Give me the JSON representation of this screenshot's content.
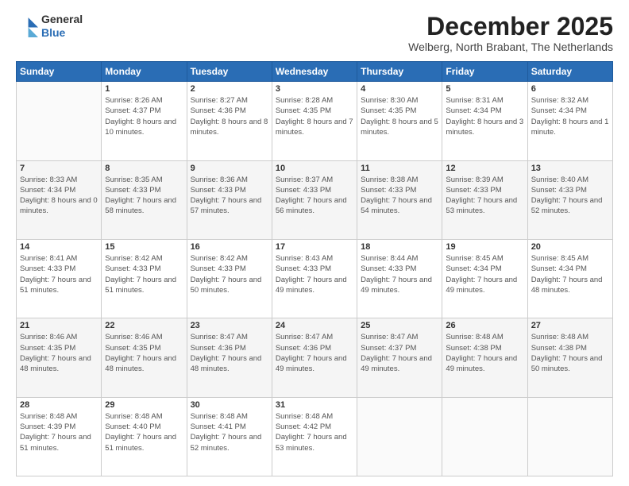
{
  "logo": {
    "general": "General",
    "blue": "Blue"
  },
  "header": {
    "month": "December 2025",
    "location": "Welberg, North Brabant, The Netherlands"
  },
  "weekdays": [
    "Sunday",
    "Monday",
    "Tuesday",
    "Wednesday",
    "Thursday",
    "Friday",
    "Saturday"
  ],
  "days": [
    {
      "date": "",
      "sunrise": "",
      "sunset": "",
      "daylight": ""
    },
    {
      "date": "1",
      "sunrise": "Sunrise: 8:26 AM",
      "sunset": "Sunset: 4:37 PM",
      "daylight": "Daylight: 8 hours and 10 minutes."
    },
    {
      "date": "2",
      "sunrise": "Sunrise: 8:27 AM",
      "sunset": "Sunset: 4:36 PM",
      "daylight": "Daylight: 8 hours and 8 minutes."
    },
    {
      "date": "3",
      "sunrise": "Sunrise: 8:28 AM",
      "sunset": "Sunset: 4:35 PM",
      "daylight": "Daylight: 8 hours and 7 minutes."
    },
    {
      "date": "4",
      "sunrise": "Sunrise: 8:30 AM",
      "sunset": "Sunset: 4:35 PM",
      "daylight": "Daylight: 8 hours and 5 minutes."
    },
    {
      "date": "5",
      "sunrise": "Sunrise: 8:31 AM",
      "sunset": "Sunset: 4:34 PM",
      "daylight": "Daylight: 8 hours and 3 minutes."
    },
    {
      "date": "6",
      "sunrise": "Sunrise: 8:32 AM",
      "sunset": "Sunset: 4:34 PM",
      "daylight": "Daylight: 8 hours and 1 minute."
    },
    {
      "date": "7",
      "sunrise": "Sunrise: 8:33 AM",
      "sunset": "Sunset: 4:34 PM",
      "daylight": "Daylight: 8 hours and 0 minutes."
    },
    {
      "date": "8",
      "sunrise": "Sunrise: 8:35 AM",
      "sunset": "Sunset: 4:33 PM",
      "daylight": "Daylight: 7 hours and 58 minutes."
    },
    {
      "date": "9",
      "sunrise": "Sunrise: 8:36 AM",
      "sunset": "Sunset: 4:33 PM",
      "daylight": "Daylight: 7 hours and 57 minutes."
    },
    {
      "date": "10",
      "sunrise": "Sunrise: 8:37 AM",
      "sunset": "Sunset: 4:33 PM",
      "daylight": "Daylight: 7 hours and 56 minutes."
    },
    {
      "date": "11",
      "sunrise": "Sunrise: 8:38 AM",
      "sunset": "Sunset: 4:33 PM",
      "daylight": "Daylight: 7 hours and 54 minutes."
    },
    {
      "date": "12",
      "sunrise": "Sunrise: 8:39 AM",
      "sunset": "Sunset: 4:33 PM",
      "daylight": "Daylight: 7 hours and 53 minutes."
    },
    {
      "date": "13",
      "sunrise": "Sunrise: 8:40 AM",
      "sunset": "Sunset: 4:33 PM",
      "daylight": "Daylight: 7 hours and 52 minutes."
    },
    {
      "date": "14",
      "sunrise": "Sunrise: 8:41 AM",
      "sunset": "Sunset: 4:33 PM",
      "daylight": "Daylight: 7 hours and 51 minutes."
    },
    {
      "date": "15",
      "sunrise": "Sunrise: 8:42 AM",
      "sunset": "Sunset: 4:33 PM",
      "daylight": "Daylight: 7 hours and 51 minutes."
    },
    {
      "date": "16",
      "sunrise": "Sunrise: 8:42 AM",
      "sunset": "Sunset: 4:33 PM",
      "daylight": "Daylight: 7 hours and 50 minutes."
    },
    {
      "date": "17",
      "sunrise": "Sunrise: 8:43 AM",
      "sunset": "Sunset: 4:33 PM",
      "daylight": "Daylight: 7 hours and 49 minutes."
    },
    {
      "date": "18",
      "sunrise": "Sunrise: 8:44 AM",
      "sunset": "Sunset: 4:33 PM",
      "daylight": "Daylight: 7 hours and 49 minutes."
    },
    {
      "date": "19",
      "sunrise": "Sunrise: 8:45 AM",
      "sunset": "Sunset: 4:34 PM",
      "daylight": "Daylight: 7 hours and 49 minutes."
    },
    {
      "date": "20",
      "sunrise": "Sunrise: 8:45 AM",
      "sunset": "Sunset: 4:34 PM",
      "daylight": "Daylight: 7 hours and 48 minutes."
    },
    {
      "date": "21",
      "sunrise": "Sunrise: 8:46 AM",
      "sunset": "Sunset: 4:35 PM",
      "daylight": "Daylight: 7 hours and 48 minutes."
    },
    {
      "date": "22",
      "sunrise": "Sunrise: 8:46 AM",
      "sunset": "Sunset: 4:35 PM",
      "daylight": "Daylight: 7 hours and 48 minutes."
    },
    {
      "date": "23",
      "sunrise": "Sunrise: 8:47 AM",
      "sunset": "Sunset: 4:36 PM",
      "daylight": "Daylight: 7 hours and 48 minutes."
    },
    {
      "date": "24",
      "sunrise": "Sunrise: 8:47 AM",
      "sunset": "Sunset: 4:36 PM",
      "daylight": "Daylight: 7 hours and 49 minutes."
    },
    {
      "date": "25",
      "sunrise": "Sunrise: 8:47 AM",
      "sunset": "Sunset: 4:37 PM",
      "daylight": "Daylight: 7 hours and 49 minutes."
    },
    {
      "date": "26",
      "sunrise": "Sunrise: 8:48 AM",
      "sunset": "Sunset: 4:38 PM",
      "daylight": "Daylight: 7 hours and 49 minutes."
    },
    {
      "date": "27",
      "sunrise": "Sunrise: 8:48 AM",
      "sunset": "Sunset: 4:38 PM",
      "daylight": "Daylight: 7 hours and 50 minutes."
    },
    {
      "date": "28",
      "sunrise": "Sunrise: 8:48 AM",
      "sunset": "Sunset: 4:39 PM",
      "daylight": "Daylight: 7 hours and 51 minutes."
    },
    {
      "date": "29",
      "sunrise": "Sunrise: 8:48 AM",
      "sunset": "Sunset: 4:40 PM",
      "daylight": "Daylight: 7 hours and 51 minutes."
    },
    {
      "date": "30",
      "sunrise": "Sunrise: 8:48 AM",
      "sunset": "Sunset: 4:41 PM",
      "daylight": "Daylight: 7 hours and 52 minutes."
    },
    {
      "date": "31",
      "sunrise": "Sunrise: 8:48 AM",
      "sunset": "Sunset: 4:42 PM",
      "daylight": "Daylight: 7 hours and 53 minutes."
    }
  ]
}
